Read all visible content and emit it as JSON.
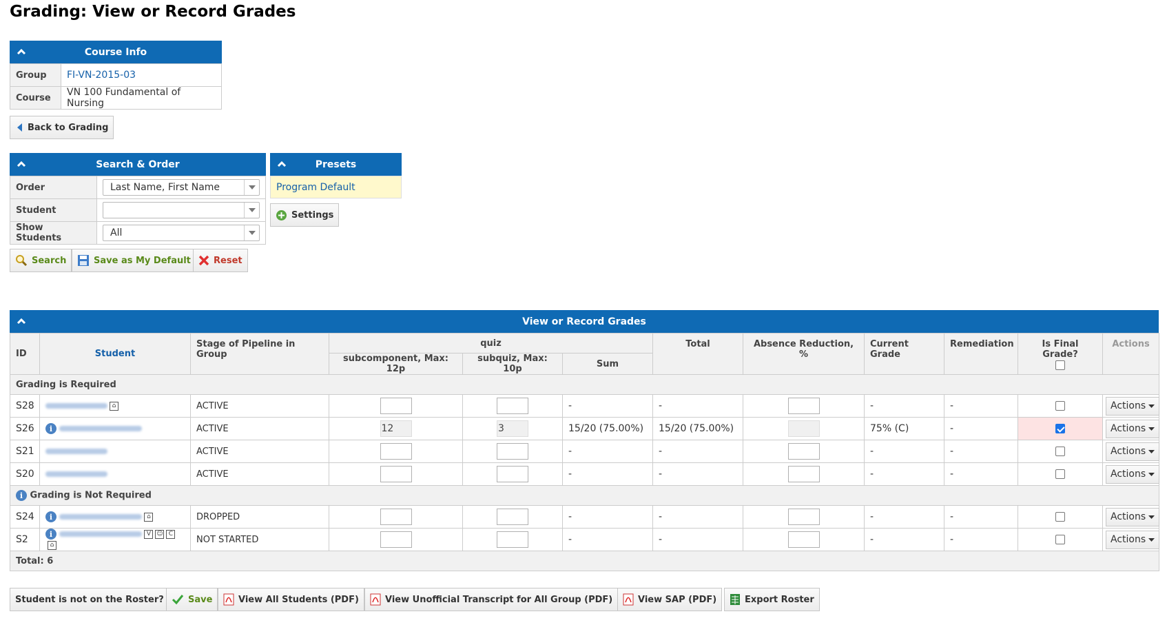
{
  "page_title": "Grading: View or Record Grades",
  "course_info": {
    "title": "Course Info",
    "rows": [
      {
        "label": "Group",
        "value": "FI-VN-2015-03",
        "link": true
      },
      {
        "label": "Course",
        "value": "VN 100 Fundamental of Nursing",
        "link": false
      }
    ]
  },
  "back_button": "Back to Grading",
  "search_order": {
    "title": "Search & Order",
    "order_label": "Order",
    "order_value": "Last Name, First Name",
    "student_label": "Student",
    "student_value": "",
    "show_label": "Show Students",
    "show_value": "All"
  },
  "search_buttons": {
    "search": "Search",
    "save_default": "Save as My Default",
    "reset": "Reset"
  },
  "presets": {
    "title": "Presets",
    "item": "Program Default",
    "settings": "Settings"
  },
  "grades": {
    "title": "View or Record Grades",
    "headers": {
      "id": "ID",
      "student": "Student",
      "stage": "Stage of Pipeline in Group",
      "quiz": "quiz",
      "subcomponent": "subcomponent, Max: 12p",
      "subquiz": "subquiz, Max: 10p",
      "sum": "Sum",
      "total": "Total",
      "absence": "Absence Reduction, %",
      "current": "Current Grade",
      "remediation": "Remediation",
      "final": "Is Final Grade?",
      "actions": "Actions"
    },
    "group_required": "Grading is Required",
    "group_not_required": "Grading is Not Required",
    "rows_required": [
      {
        "id": "S28",
        "stage": "ACTIVE",
        "sub": "",
        "subquiz": "",
        "sum": "-",
        "total": "-",
        "current": "-",
        "remediation": "-",
        "final": false,
        "info": false,
        "icons": [
          "house"
        ],
        "readonly": false
      },
      {
        "id": "S26",
        "stage": "ACTIVE",
        "sub": "12",
        "subquiz": "3",
        "sum": "15/20 (75.00%)",
        "total": "15/20 (75.00%)",
        "current": "75% (C)",
        "remediation": "-",
        "final": true,
        "info": true,
        "icons": [],
        "readonly": true
      },
      {
        "id": "S21",
        "stage": "ACTIVE",
        "sub": "",
        "subquiz": "",
        "sum": "-",
        "total": "-",
        "current": "-",
        "remediation": "-",
        "final": false,
        "info": false,
        "icons": [],
        "readonly": false
      },
      {
        "id": "S20",
        "stage": "ACTIVE",
        "sub": "",
        "subquiz": "",
        "sum": "-",
        "total": "-",
        "current": "-",
        "remediation": "-",
        "final": false,
        "info": false,
        "icons": [],
        "readonly": false
      }
    ],
    "rows_not_required": [
      {
        "id": "S24",
        "stage": "DROPPED",
        "sub": "",
        "subquiz": "",
        "sum": "-",
        "total": "-",
        "current": "-",
        "remediation": "-",
        "final": false,
        "info": true,
        "icons": [
          "house"
        ],
        "readonly": false
      },
      {
        "id": "S2",
        "stage": "NOT STARTED",
        "sub": "",
        "subquiz": "",
        "sum": "-",
        "total": "-",
        "current": "-",
        "remediation": "-",
        "final": false,
        "info": true,
        "icons": [
          "V",
          "person",
          "C",
          "house"
        ],
        "readonly": false
      }
    ],
    "actions_label": "Actions",
    "total_label": "Total: 6"
  },
  "bottom_buttons": {
    "not_on_roster": "Student is not on the Roster?",
    "save": "Save",
    "view_all_pdf": "View All Students (PDF)",
    "transcript_pdf": "View Unofficial Transcript for All Group (PDF)",
    "sap_pdf": "View SAP (PDF)",
    "export": "Export Roster"
  },
  "colors": {
    "header_blue": "#0f6ab4",
    "link": "#1560a9",
    "preset_bg": "#fff9cc",
    "final_bg": "#fde3e3"
  }
}
